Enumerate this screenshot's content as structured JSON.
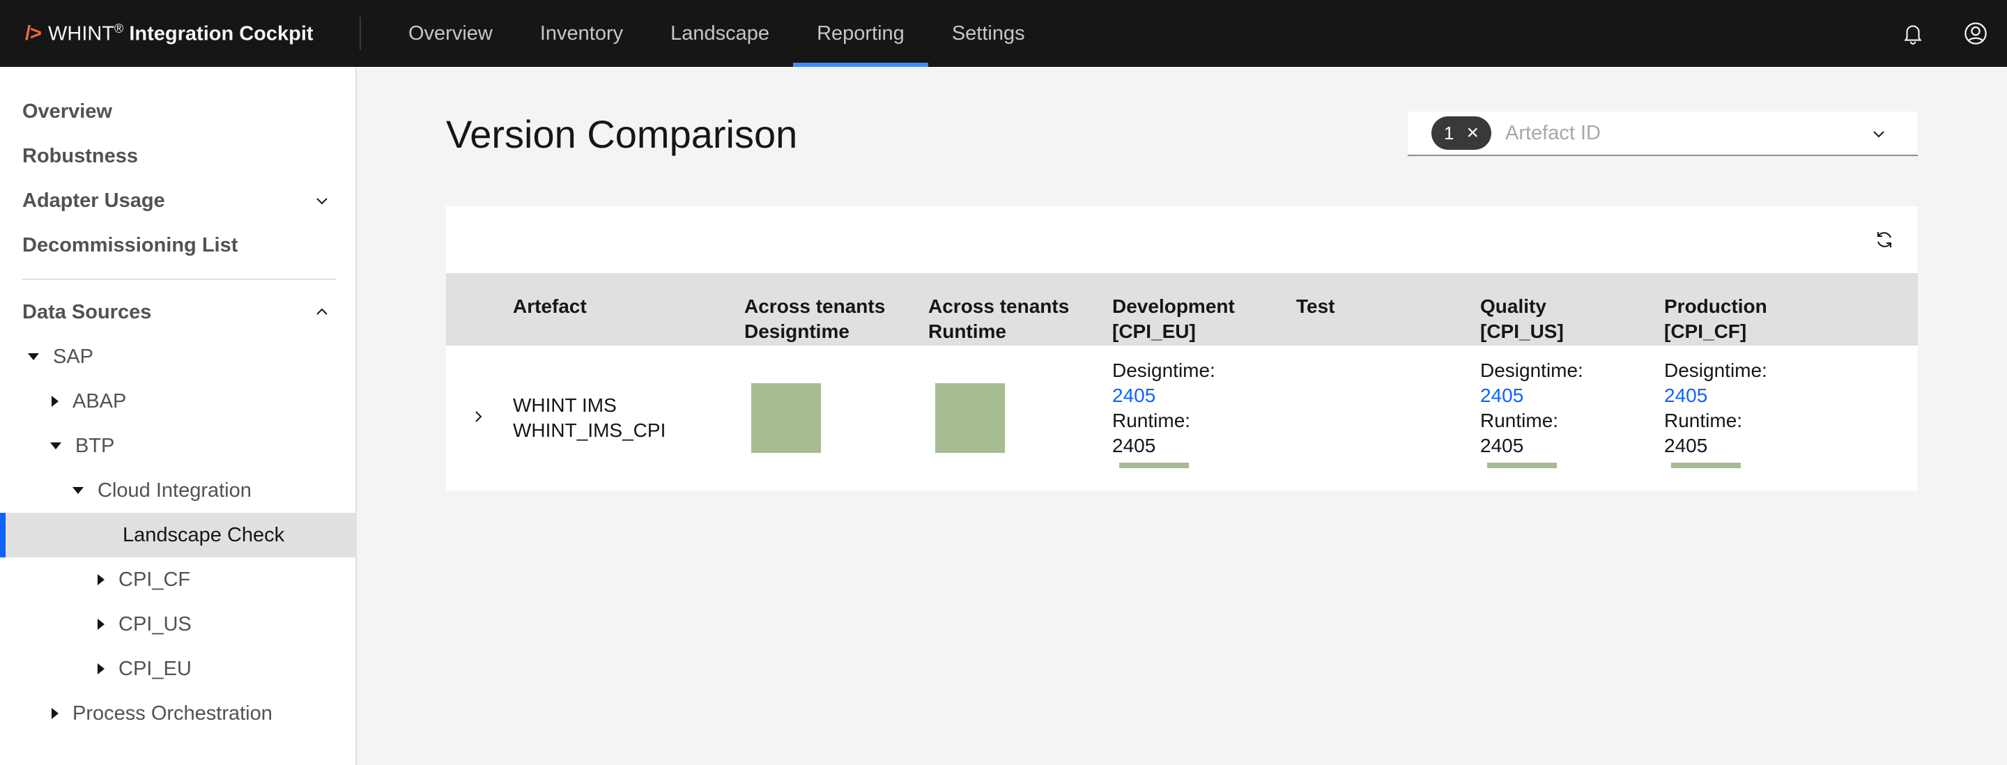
{
  "header": {
    "brand_mark": "/>",
    "brand_name_prefix": "WHINT",
    "brand_reg": "®",
    "brand_name_suffix": " Integration Cockpit",
    "nav": [
      {
        "label": "Overview"
      },
      {
        "label": "Inventory"
      },
      {
        "label": "Landscape"
      },
      {
        "label": "Reporting",
        "active": true
      },
      {
        "label": "Settings"
      }
    ],
    "icons": [
      "bell-icon",
      "user-avatar-icon"
    ]
  },
  "sidebar": {
    "top_items": [
      {
        "label": "Overview"
      },
      {
        "label": "Robustness"
      },
      {
        "label": "Adapter Usage"
      },
      {
        "label": "Decommissioning List"
      }
    ],
    "data_sources_label": "Data Sources",
    "tree": {
      "sap": "SAP",
      "abap": "ABAP",
      "btp": "BTP",
      "cloud_integration": "Cloud Integration",
      "landscape_check": "Landscape Check",
      "cpi_cf": "CPI_CF",
      "cpi_us": "CPI_US",
      "cpi_eu": "CPI_EU",
      "process_orchestration": "Process Orchestration"
    }
  },
  "page": {
    "title": "Version Comparison",
    "filter": {
      "tag_count": "1",
      "tag_close": "×",
      "placeholder": "Artefact ID"
    }
  },
  "table": {
    "headers": {
      "artefact": "Artefact",
      "across_design_1": "Across tenants",
      "across_design_2": "Designtime",
      "across_runtime_1": "Across tenants",
      "across_runtime_2": "Runtime",
      "dev_1": "Development",
      "dev_2": "[CPI_EU]",
      "test": "Test",
      "quality_1": "Quality",
      "quality_2": "[CPI_US]",
      "prod_1": "Production",
      "prod_2": "[CPI_CF]"
    },
    "row": {
      "artefact_name": "WHINT IMS",
      "artefact_id": "WHINT_IMS_CPI",
      "designtime_label": "Designtime:",
      "runtime_label": "Runtime:",
      "dev_designtime": "2405",
      "dev_runtime": "2405",
      "quality_designtime": "2405",
      "quality_runtime": "2405",
      "prod_designtime": "2405",
      "prod_runtime": "2405"
    }
  },
  "colors": {
    "accent": "#4589ff",
    "link": "#0f62fe",
    "match_green": "#a7bc92",
    "header_bg": "#161616"
  }
}
